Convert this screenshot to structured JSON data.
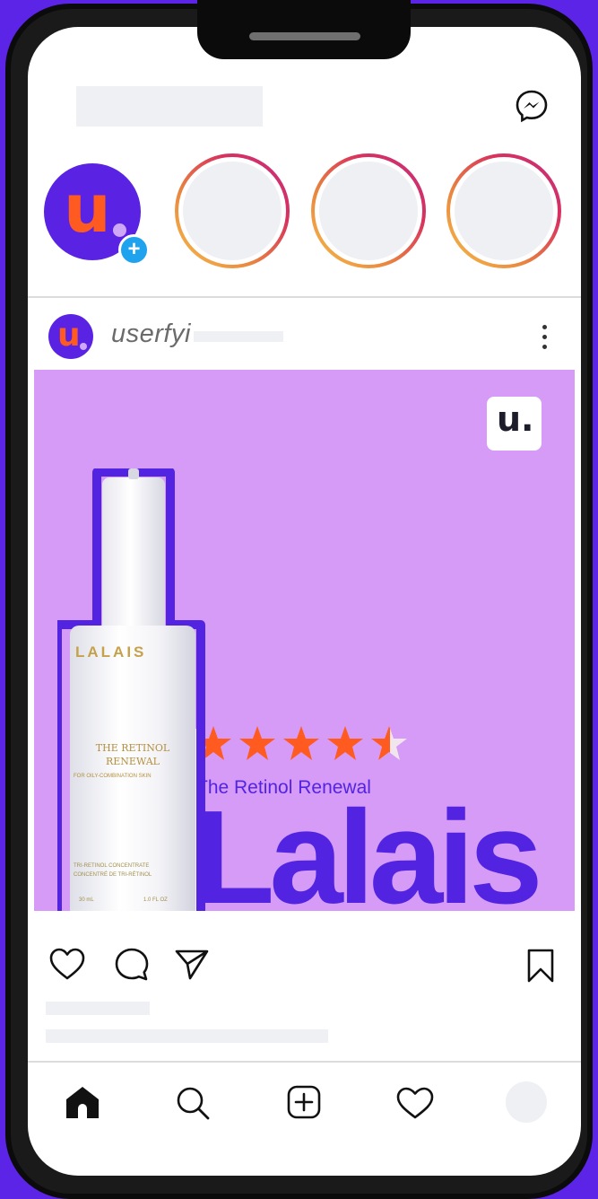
{
  "header": {
    "messenger_icon": "messenger-icon"
  },
  "stories": {
    "own_story": {
      "logo_letter": "u",
      "add_badge": "+"
    },
    "others": 3
  },
  "post": {
    "username": "userfyi",
    "more_icon": "more-vertical-icon",
    "image": {
      "brand_tile_text": "u.",
      "rating_stars": 4.5,
      "rating_max": 5,
      "product_line": "The Retinol Renewal",
      "big_brand": "Lalais",
      "bottle": {
        "brand": "LALAIS",
        "name_line1": "THE RETINOL",
        "name_line2": "RENEWAL",
        "sub": "FOR OILY-COMBINATION SKIN",
        "concentrate_en": "TRI-RETINOL CONCENTRATE",
        "concentrate_fr": "CONCENTRÉ DE TRI-RÉTINOL",
        "volume_ml": "30 mL",
        "volume_oz": "1.0 FL OZ"
      }
    },
    "actions": [
      "heart-icon",
      "comment-icon",
      "share-icon",
      "bookmark-icon"
    ]
  },
  "bottom_nav": [
    "home-icon",
    "search-icon",
    "add-post-icon",
    "activity-heart-icon",
    "profile-avatar"
  ],
  "colors": {
    "background": "#5b24e6",
    "brand_purple": "#5224e2",
    "post_bg": "#d59bf7",
    "accent_orange": "#ff5a1f",
    "star": "#ff5a1f",
    "badge_blue": "#1fa3ee"
  }
}
